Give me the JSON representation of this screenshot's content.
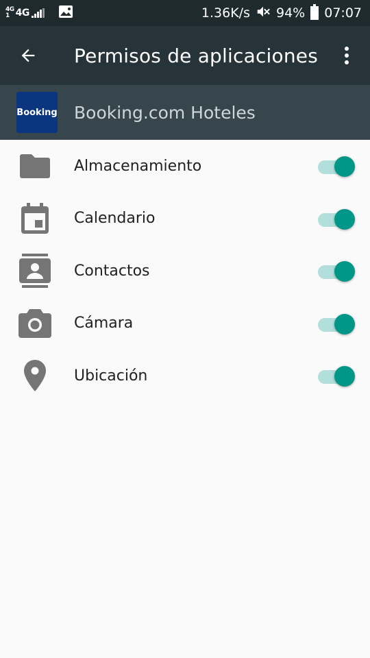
{
  "status_bar": {
    "network_small": [
      "4G",
      "1"
    ],
    "network_main": "4G",
    "speed": "1.36K/s",
    "battery": "94%",
    "time": "07:07"
  },
  "app_bar": {
    "title": "Permisos de aplicaciones",
    "back_icon": "arrow-back-icon",
    "more_icon": "more-vert-icon"
  },
  "app": {
    "logo_text": "Booking",
    "name": "Booking.com Hoteles",
    "logo_color": "#0c3580"
  },
  "permissions": [
    {
      "label": "Almacenamiento",
      "icon": "folder-icon",
      "enabled": true
    },
    {
      "label": "Calendario",
      "icon": "calendar-icon",
      "enabled": true
    },
    {
      "label": "Contactos",
      "icon": "contacts-icon",
      "enabled": true
    },
    {
      "label": "Cámara",
      "icon": "camera-icon",
      "enabled": true
    },
    {
      "label": "Ubicación",
      "icon": "location-icon",
      "enabled": true
    }
  ],
  "colors": {
    "accent": "#009688",
    "track": "#b2dfdb",
    "toolbar": "#26343a",
    "header": "#36464c"
  }
}
